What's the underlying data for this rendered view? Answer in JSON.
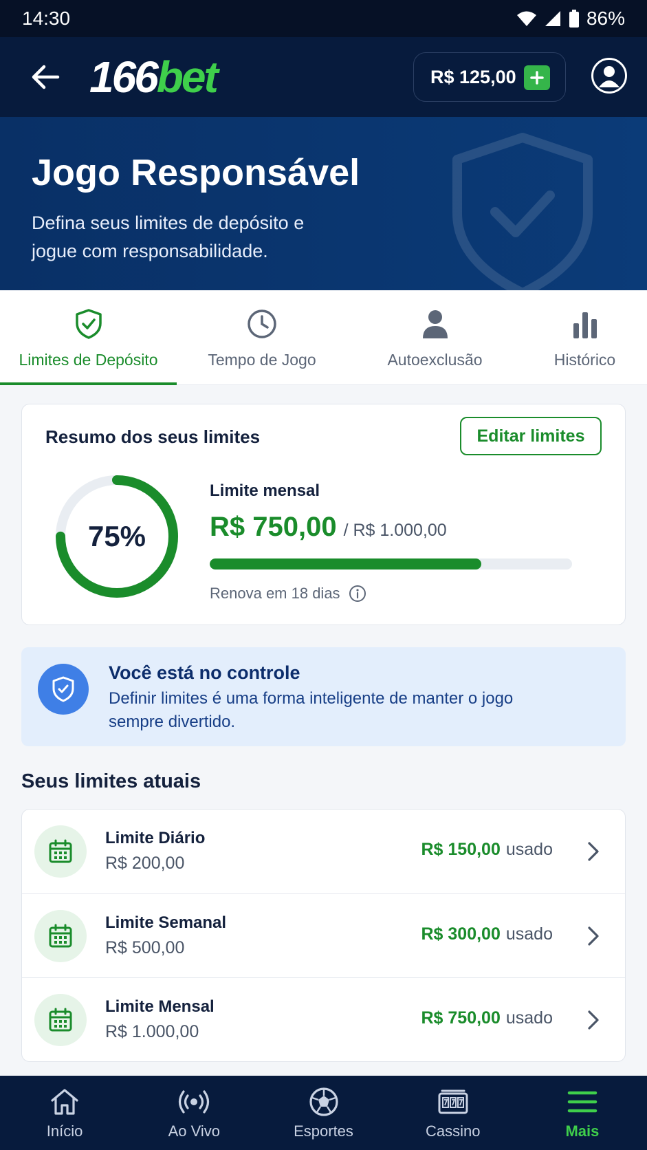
{
  "status_bar": {
    "time": "14:30",
    "battery": "86%"
  },
  "header": {
    "logo_num": "166",
    "logo_bet": "bet",
    "balance": "R$ 125,00",
    "brand_color": "#3fcf4b"
  },
  "hero": {
    "title": "Jogo Responsável",
    "subtitle": "Defina seus limites de depósito e jogue com responsabilidade."
  },
  "tabs": [
    {
      "label": "Limites de Depósito",
      "icon": "shield-check-icon",
      "active": true
    },
    {
      "label": "Tempo de Jogo",
      "icon": "clock-icon",
      "active": false
    },
    {
      "label": "Autoexclusão",
      "icon": "person-icon",
      "active": false
    },
    {
      "label": "Histórico",
      "icon": "bar-chart-icon",
      "active": false
    }
  ],
  "summary": {
    "title": "Resumo dos seus limites",
    "edit_label": "Editar limites",
    "percent_label": "75%",
    "percent_value": 0.75,
    "monthly_label": "Limite mensal",
    "used": "R$ 750,00",
    "total": "/ R$ 1.000,00",
    "renew": "Renova em 18 dias"
  },
  "info": {
    "title": "Você está no controle",
    "text": "Definir limites é uma forma inteligente de manter o jogo sempre divertido."
  },
  "limits_section": {
    "title": "Seus limites atuais",
    "used_suffix": "usado",
    "items": [
      {
        "name": "Limite Diário",
        "max": "R$ 200,00",
        "used": "R$ 150,00"
      },
      {
        "name": "Limite Semanal",
        "max": "R$ 500,00",
        "used": "R$ 300,00"
      },
      {
        "name": "Limite Mensal",
        "max": "R$ 1.000,00",
        "used": "R$ 750,00"
      }
    ]
  },
  "bottom_nav": [
    {
      "label": "Início",
      "icon": "home-icon",
      "active": false
    },
    {
      "label": "Ao Vivo",
      "icon": "live-icon",
      "active": false
    },
    {
      "label": "Esportes",
      "icon": "soccer-ball-icon",
      "active": false
    },
    {
      "label": "Cassino",
      "icon": "slot-machine-icon",
      "active": false
    },
    {
      "label": "Mais",
      "icon": "menu-icon",
      "active": true
    }
  ],
  "colors": {
    "accent_green": "#1a8c2b",
    "navy": "#071b3d",
    "info_blue": "#3f7fe6"
  }
}
